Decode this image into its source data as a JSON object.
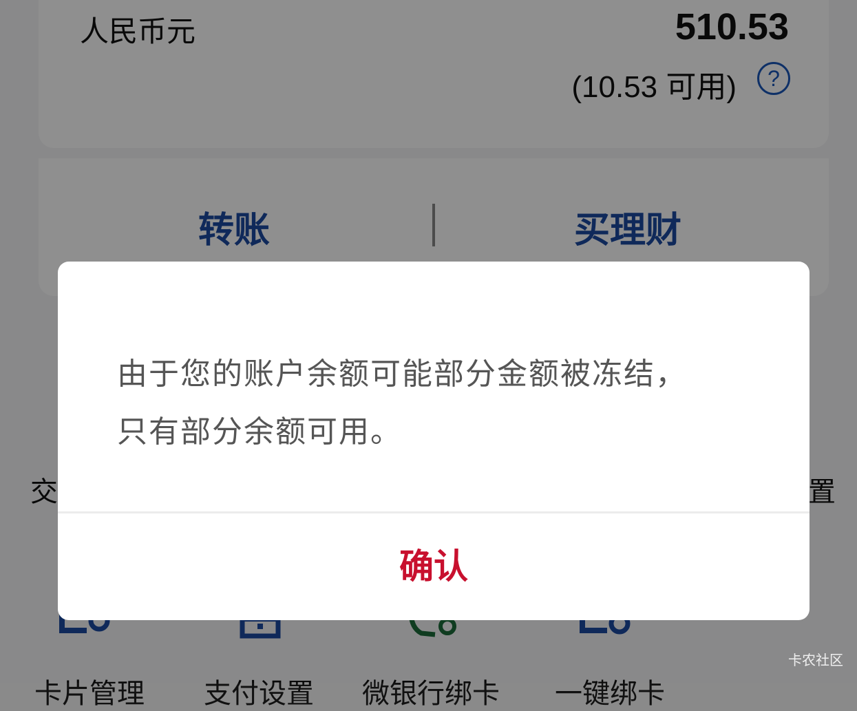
{
  "account": {
    "currency": "人民币元",
    "balance": "510.53",
    "available": "(10.53 可用)",
    "help_symbol": "?"
  },
  "actions": {
    "transfer": "转账",
    "buy_finance": "买理财"
  },
  "side_labels": {
    "left": "交",
    "right": "置"
  },
  "bottom_items": [
    {
      "label": "卡片管理"
    },
    {
      "label": "支付设置"
    },
    {
      "label": "微银行绑卡"
    },
    {
      "label": "一键绑卡"
    }
  ],
  "dialog": {
    "line1": "由于您的账户余额可能部分金额被冻结，",
    "line2": "只有部分余额可用。",
    "confirm": "确认"
  },
  "watermark": "卡农社区",
  "colors": {
    "accent_blue": "#1b4aa0",
    "confirm_red": "#c8102e"
  }
}
